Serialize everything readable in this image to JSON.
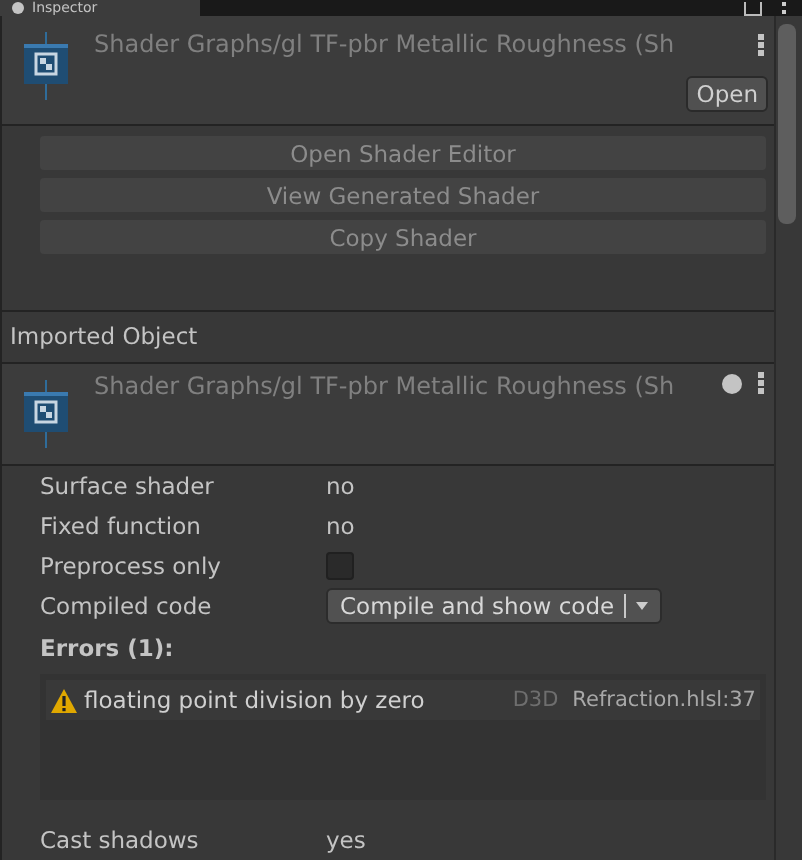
{
  "tabs": [
    {
      "label": "Inspector",
      "selected": true
    }
  ],
  "header": {
    "title": "Shader Graphs/gl TF-pbr Metallic Roughness (Sh",
    "open_button": "Open"
  },
  "actions": [
    "Open Shader Editor",
    "View Generated Shader",
    "Copy Shader"
  ],
  "section": {
    "title": "Imported Object"
  },
  "imported_header": {
    "title": "Shader Graphs/gl TF-pbr Metallic Roughness (Sh"
  },
  "properties": [
    {
      "kind": "text",
      "label": "Surface shader",
      "value": "no"
    },
    {
      "kind": "text",
      "label": "Fixed function",
      "value": "no"
    },
    {
      "kind": "checkbox",
      "label": "Preprocess only",
      "checked": false
    },
    {
      "kind": "dropdown",
      "label": "Compiled code",
      "value": "Compile and show code"
    }
  ],
  "errors": {
    "title": "Errors (1):",
    "items": [
      {
        "message": "floating point division by zero",
        "api": "D3D",
        "location": "Refraction.hlsl:37"
      }
    ]
  },
  "after": [
    {
      "kind": "text",
      "label": "Cast shadows",
      "value": "yes"
    }
  ]
}
